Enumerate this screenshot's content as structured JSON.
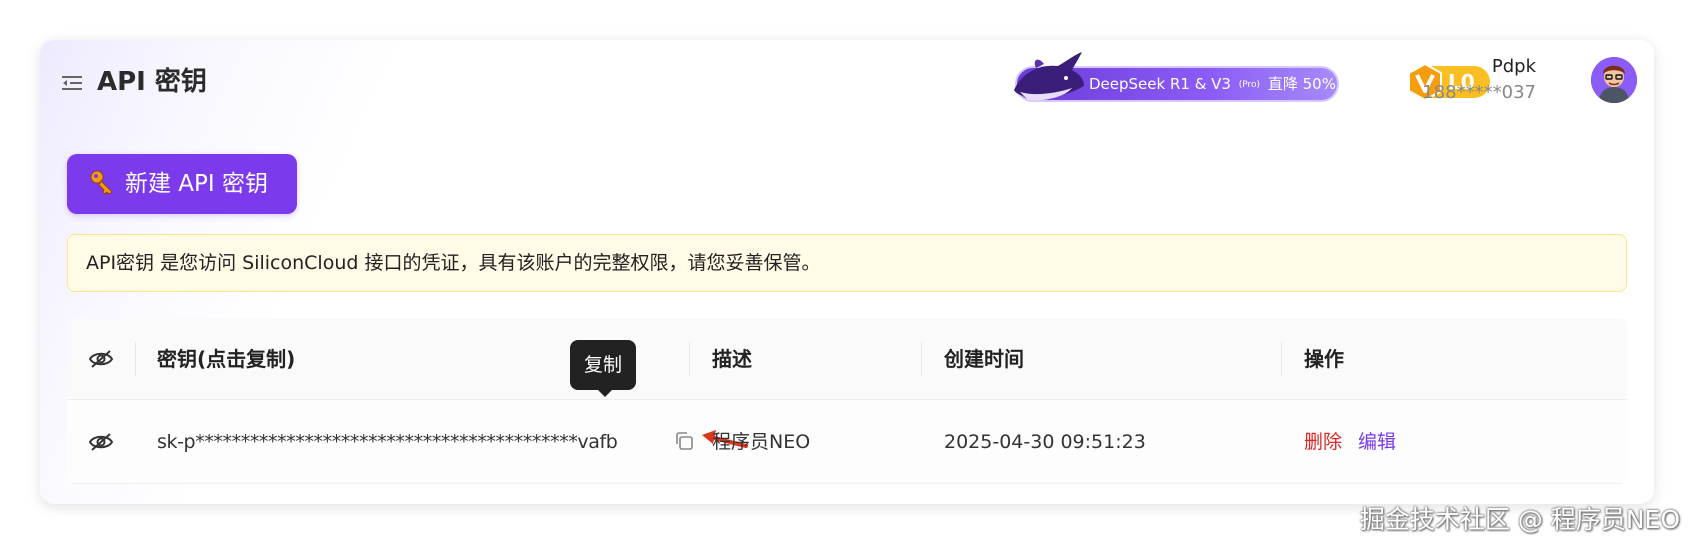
{
  "header": {
    "title": "API 密钥",
    "promo": {
      "text_main": "DeepSeek R1 & V3",
      "text_pro": "(Pro)",
      "text_discount": "直降 50%"
    },
    "level_badge": "L0",
    "user": {
      "name": "Pdpk",
      "phone": "188*****037"
    }
  },
  "actions": {
    "new_key_label": "新建 API 密钥"
  },
  "notice": {
    "text": "API密钥 是您访问 SiliconCloud 接口的凭证，具有该账户的完整权限，请您妥善保管。"
  },
  "table": {
    "columns": {
      "key": "密钥(点击复制)",
      "description": "描述",
      "created": "创建时间",
      "actions": "操作"
    },
    "rows": [
      {
        "key": "sk-p******************************************vafb",
        "description": "程序员NEO",
        "created": "2025-04-30 09:51:23",
        "delete_label": "删除",
        "edit_label": "编辑"
      }
    ]
  },
  "tooltip": {
    "text": "复制"
  },
  "watermark": {
    "text": "掘金技术社区 @ 程序员NEO"
  },
  "colors": {
    "primary": "#7c3aed",
    "danger": "#dc2626",
    "badge": "#fbbf24",
    "notice_bg": "#fffbe6"
  },
  "icons": {
    "menu": "menu-collapse-icon",
    "eye_off": "eye-off-icon",
    "copy": "copy-icon",
    "key": "key-icon",
    "arrow": "red-arrow-icon"
  }
}
